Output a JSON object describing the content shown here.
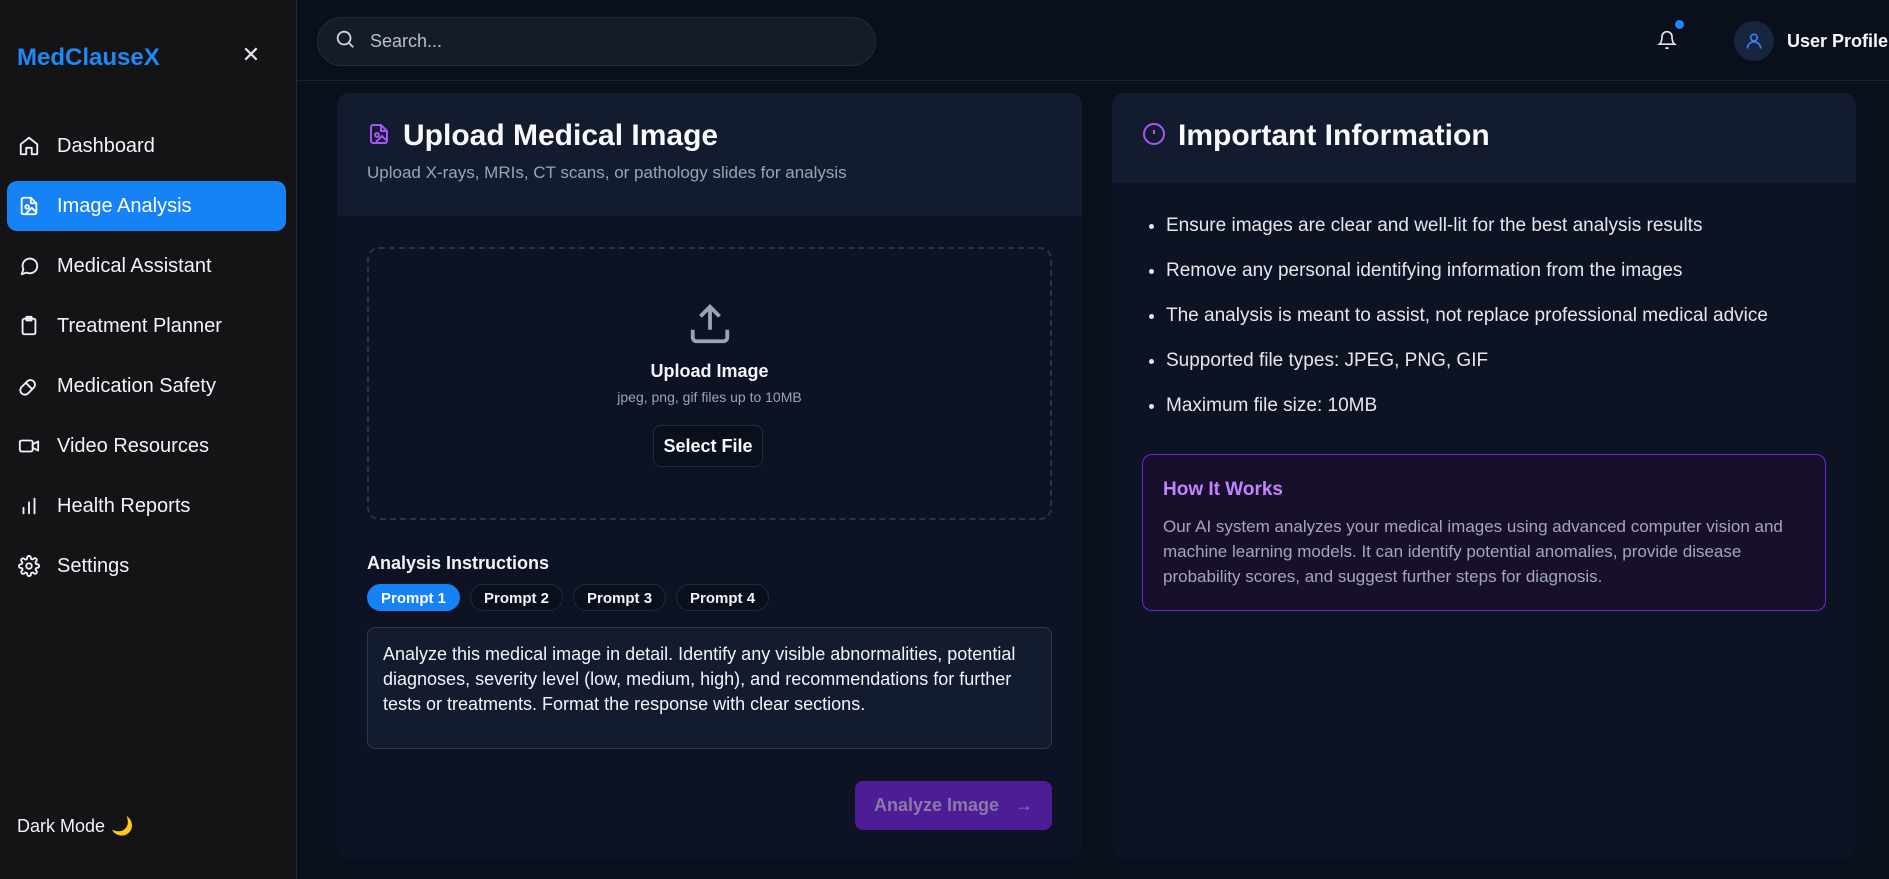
{
  "sidebar": {
    "brand": "MedClauseX",
    "close_icon": "close-icon",
    "items": [
      {
        "label": "Dashboard",
        "icon": "home-icon",
        "active": false
      },
      {
        "label": "Image Analysis",
        "icon": "image-file-icon",
        "active": true
      },
      {
        "label": "Medical Assistant",
        "icon": "chat-bubble-icon",
        "active": false
      },
      {
        "label": "Treatment Planner",
        "icon": "clipboard-icon",
        "active": false
      },
      {
        "label": "Medication Safety",
        "icon": "pill-icon",
        "active": false
      },
      {
        "label": "Video Resources",
        "icon": "video-camera-icon",
        "active": false
      },
      {
        "label": "Health Reports",
        "icon": "bar-chart-icon",
        "active": false
      },
      {
        "label": "Settings",
        "icon": "gear-icon",
        "active": false
      }
    ],
    "dark_mode_label": "Dark Mode",
    "dark_mode_emoji": "🌙"
  },
  "topbar": {
    "search_placeholder": "Search...",
    "profile_name": "User Profile"
  },
  "upload": {
    "title": "Upload Medical Image",
    "subtitle": "Upload X-rays, MRIs, CT scans, or pathology slides for analysis",
    "dropzone_title": "Upload Image",
    "dropzone_hint": "jpeg, png, gif files up to 10MB",
    "select_button": "Select File",
    "instructions_label": "Analysis Instructions",
    "prompts": [
      "Prompt 1",
      "Prompt 2",
      "Prompt 3",
      "Prompt 4"
    ],
    "active_prompt": 0,
    "instructions_value": "Analyze this medical image in detail. Identify any visible abnormalities, potential diagnoses, severity level (low, medium, high), and recommendations for further tests or treatments. Format the response with clear sections.",
    "analyze_button": "Analyze Image"
  },
  "info": {
    "title": "Important Information",
    "bullets": [
      "Ensure images are clear and well-lit for the best analysis results",
      "Remove any personal identifying information from the images",
      "The analysis is meant to assist, not replace professional medical advice",
      "Supported file types: JPEG, PNG, GIF",
      "Maximum file size: 10MB"
    ],
    "how_title": "How It Works",
    "how_text": "Our AI system analyzes your medical images using advanced computer vision and machine learning models. It can identify potential anomalies, provide disease probability scores, and suggest further steps for diagnosis."
  },
  "colors": {
    "accent": "#1583f5",
    "purple": "#a855f7",
    "background": "#0a0f1c"
  }
}
